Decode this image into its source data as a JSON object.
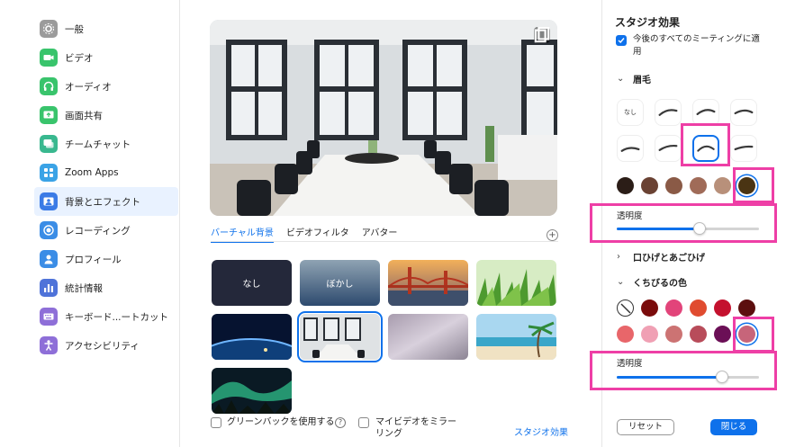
{
  "sidebar": {
    "items": [
      {
        "label": "一般",
        "icon": "gear-icon",
        "color": "#9b9b9b",
        "active": false
      },
      {
        "label": "ビデオ",
        "icon": "video-icon",
        "color": "#39c46c",
        "active": false
      },
      {
        "label": "オーディオ",
        "icon": "headphones-icon",
        "color": "#39c46c",
        "active": false
      },
      {
        "label": "画面共有",
        "icon": "screen-share-icon",
        "color": "#39c46c",
        "active": false
      },
      {
        "label": "チームチャット",
        "icon": "chat-icon",
        "color": "#39b88f",
        "active": false
      },
      {
        "label": "Zoom Apps",
        "icon": "apps-icon",
        "color": "#3ba3e6",
        "active": false
      },
      {
        "label": "背景とエフェクト",
        "icon": "background-icon",
        "color": "#3b7be6",
        "active": true
      },
      {
        "label": "レコーディング",
        "icon": "record-icon",
        "color": "#3b8de6",
        "active": false
      },
      {
        "label": "プロフィール",
        "icon": "profile-icon",
        "color": "#3b8de6",
        "active": false
      },
      {
        "label": "統計情報",
        "icon": "stats-icon",
        "color": "#4f73d9",
        "active": false
      },
      {
        "label": "キーボード...ートカット",
        "icon": "keyboard-icon",
        "color": "#8e6fd8",
        "active": false
      },
      {
        "label": "アクセシビリティ",
        "icon": "accessibility-icon",
        "color": "#8e6fd8",
        "active": false
      }
    ]
  },
  "center": {
    "tabs": [
      {
        "label": "バーチャル背景",
        "active": true
      },
      {
        "label": "ビデオフィルタ",
        "active": false
      },
      {
        "label": "アバター",
        "active": false
      }
    ],
    "add_icon": "+",
    "backgrounds": [
      {
        "label": "なし",
        "kind": "none"
      },
      {
        "label": "ぼかし",
        "kind": "blur"
      },
      {
        "label": "",
        "kind": "golden-gate-bridge"
      },
      {
        "label": "",
        "kind": "grass"
      },
      {
        "label": "",
        "kind": "earth-from-space"
      },
      {
        "label": "",
        "kind": "office-room",
        "selected": true
      },
      {
        "label": "",
        "kind": "purple-gradient"
      },
      {
        "label": "",
        "kind": "beach"
      },
      {
        "label": "",
        "kind": "aurora"
      }
    ],
    "green_screen_label": "グリーンバックを使用する",
    "help_icon": "?",
    "mirror_label_line1": "マイビデオをミラー",
    "mirror_label_line2": "リング",
    "studio_link": "スタジオ効果"
  },
  "studio": {
    "title": "スタジオ効果",
    "apply_all_label": "今後のすべてのミーティングに適用",
    "eyebrows": {
      "label": "眉毛",
      "none_label": "なし",
      "swatches": [
        "#2b1d17",
        "#6a4233",
        "#8a5a46",
        "#a06b58",
        "#b8907a",
        "#4a3413"
      ],
      "selected_swatch": 5,
      "opacity_label": "透明度",
      "opacity": 0.58
    },
    "mustache": {
      "label": "口ひげとあごひげ"
    },
    "lips": {
      "label": "くちびるの色",
      "swatches_row1": [
        "none",
        "#7a0b0b",
        "#e2447a",
        "#e04b2f",
        "#c4112e",
        "#5c0e0e"
      ],
      "swatches_row2": [
        "#e8666a",
        "#f0a0b4",
        "#cc7373",
        "#b84c5a",
        "#6b0f56",
        "#c7657a"
      ],
      "selected_swatch": "row2-5",
      "opacity_label": "透明度",
      "opacity": 0.74
    },
    "reset_label": "リセット",
    "close_label": "閉じる"
  },
  "colors": {
    "accent": "#0e71eb",
    "highlight": "#ee3fa6"
  }
}
